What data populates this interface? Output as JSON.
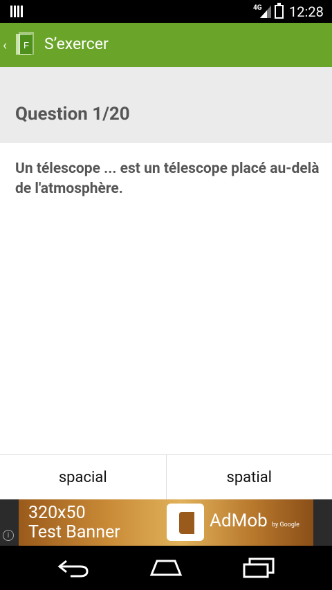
{
  "status_bar": {
    "network_label": "4G",
    "time": "12:28"
  },
  "action_bar": {
    "title": "S’exercer",
    "logo_letter": "F",
    "accent_color": "#6aa52a"
  },
  "question": {
    "header": "Question 1/20",
    "text": "Un télescope ... est un télescope placé au-delà de l'atmosphère."
  },
  "answers": [
    {
      "label": "spacial"
    },
    {
      "label": "spatial"
    }
  ],
  "ad_banner": {
    "line1": "320x50",
    "line2": "Test Banner",
    "brand": "AdMob",
    "byline": "by Google",
    "info_glyph": "i"
  },
  "nav_bar": {
    "buttons": [
      "back-icon",
      "home-icon",
      "recents-icon"
    ]
  }
}
